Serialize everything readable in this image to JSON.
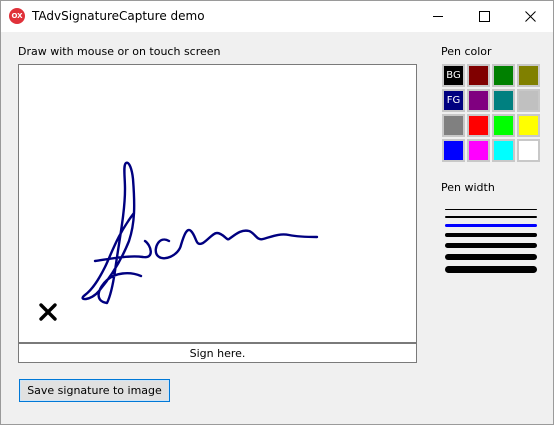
{
  "window": {
    "title": "TAdvSignatureCapture demo",
    "app_icon_text": "OX",
    "app_icon_color": "#e0313a"
  },
  "canvas": {
    "instruction": "Draw with mouse or on touch screen",
    "sign_here": "Sign here.",
    "signature_color": "#000080",
    "clear_glyph": "✕"
  },
  "actions": {
    "save_label": "Save signature to image"
  },
  "pen_color": {
    "label": "Pen color",
    "swatches": [
      {
        "color": "#000000",
        "text": "BG"
      },
      {
        "color": "#800000",
        "text": ""
      },
      {
        "color": "#008000",
        "text": ""
      },
      {
        "color": "#808000",
        "text": ""
      },
      {
        "color": "#000080",
        "text": "FG"
      },
      {
        "color": "#800080",
        "text": ""
      },
      {
        "color": "#008080",
        "text": ""
      },
      {
        "color": "#c0c0c0",
        "text": ""
      },
      {
        "color": "#808080",
        "text": ""
      },
      {
        "color": "#ff0000",
        "text": ""
      },
      {
        "color": "#00ff00",
        "text": ""
      },
      {
        "color": "#ffff00",
        "text": ""
      },
      {
        "color": "#0000ff",
        "text": ""
      },
      {
        "color": "#ff00ff",
        "text": ""
      },
      {
        "color": "#00ffff",
        "text": ""
      },
      {
        "color": "#ffffff",
        "text": ""
      }
    ]
  },
  "pen_width": {
    "label": "Pen width",
    "widths": [
      {
        "color": "#000000"
      },
      {
        "color": "#000000"
      },
      {
        "color": "#0000ff",
        "selected": true
      },
      {
        "color": "#000000"
      },
      {
        "color": "#000000"
      },
      {
        "color": "#000000"
      },
      {
        "color": "#000000"
      }
    ]
  }
}
